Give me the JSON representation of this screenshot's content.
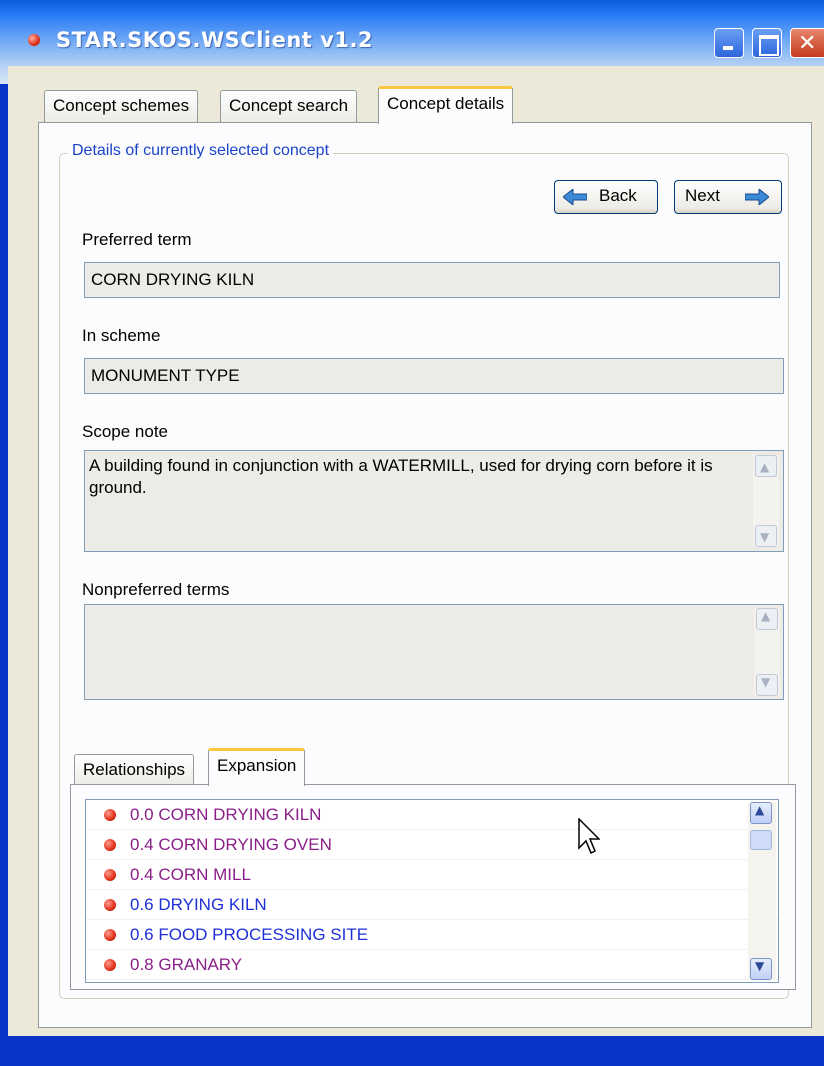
{
  "window": {
    "title": "STAR.SKOS.WSClient v1.2"
  },
  "tabs": [
    {
      "label": "Concept schemes"
    },
    {
      "label": "Concept search"
    },
    {
      "label": "Concept details"
    }
  ],
  "details": {
    "group_title": "Details of currently selected concept",
    "back_label": "Back",
    "next_label": "Next",
    "preferred_term_label": "Preferred term",
    "preferred_term_value": "CORN DRYING KILN",
    "in_scheme_label": "In scheme",
    "in_scheme_value": "MONUMENT TYPE",
    "scope_note_label": "Scope note",
    "scope_note_value": "A building found in conjunction with a WATERMILL, used for drying corn before it is ground.",
    "nonpreferred_label": "Nonpreferred terms",
    "nonpreferred_value": ""
  },
  "subtabs": [
    {
      "label": "Relationships"
    },
    {
      "label": "Expansion"
    }
  ],
  "expansion": {
    "items": [
      {
        "label": "0.0 CORN DRYING KILN",
        "color": "#8a1f8a"
      },
      {
        "label": "0.4 CORN DRYING OVEN",
        "color": "#8a1f8a"
      },
      {
        "label": "0.4 CORN MILL",
        "color": "#8a1f8a"
      },
      {
        "label": "0.6 DRYING KILN",
        "color": "#1f2fd6"
      },
      {
        "label": "0.6 FOOD PROCESSING SITE",
        "color": "#1f2fd6"
      },
      {
        "label": "0.8 GRANARY",
        "color": "#8a1f8a"
      }
    ]
  },
  "icons": {
    "app": "app-icon",
    "back": "arrow-left-icon",
    "next": "arrow-right-icon",
    "bullet": "bullet-icon",
    "cursor": "mouse-pointer-icon"
  }
}
